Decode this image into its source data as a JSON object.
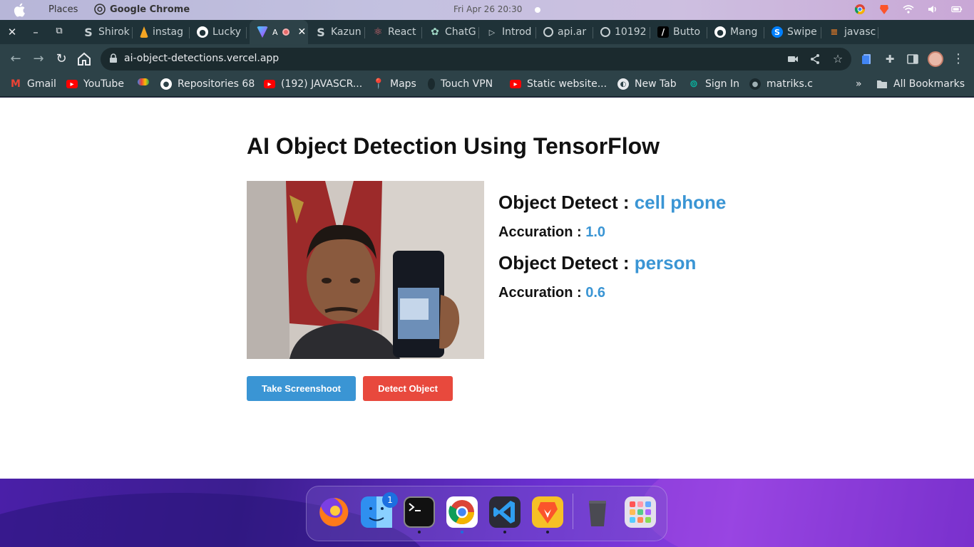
{
  "system_bar": {
    "menu_places": "Places",
    "app_name": "Google Chrome",
    "clock": "Fri Apr 26  20:30"
  },
  "tabs": [
    {
      "label": "Shirok",
      "icon": "shirok-s-icon"
    },
    {
      "label": "instag",
      "icon": "firebase-icon"
    },
    {
      "label": "Lucky",
      "icon": "github-icon"
    },
    {
      "label": "A",
      "icon": "vite-icon",
      "active": true
    },
    {
      "label": "Kazun",
      "icon": "shirok-s-icon"
    },
    {
      "label": "React",
      "icon": "react-icon"
    },
    {
      "label": "ChatG",
      "icon": "openai-icon"
    },
    {
      "label": "Introd",
      "icon": "play-icon"
    },
    {
      "label": "api.ar",
      "icon": "globe-icon"
    },
    {
      "label": "10192",
      "icon": "globe-icon"
    },
    {
      "label": "Butto",
      "icon": "slash-icon"
    },
    {
      "label": "Mang",
      "icon": "github-icon"
    },
    {
      "label": "Swipe",
      "icon": "swiper-icon"
    },
    {
      "label": "javasc",
      "icon": "stackoverflow-icon"
    }
  ],
  "toolbar": {
    "url": "ai-object-detections.vercel.app"
  },
  "bookmarks": [
    {
      "label": "Gmail",
      "icon": "gmail-icon"
    },
    {
      "label": "YouTube",
      "icon": "youtube-icon"
    },
    {
      "label": "",
      "icon": "google-cloud-icon"
    },
    {
      "label": "Repositories 68",
      "icon": "github-icon"
    },
    {
      "label": "(192) JAVASCR...",
      "icon": "youtube-icon"
    },
    {
      "label": "Maps",
      "icon": "maps-icon"
    },
    {
      "label": "Touch VPN",
      "icon": "vpn-icon"
    },
    {
      "label": "Static website...",
      "icon": "youtube-icon"
    },
    {
      "label": "New Tab",
      "icon": "globe-icon"
    },
    {
      "label": "Sign In",
      "icon": "codeium-icon"
    },
    {
      "label": "matriks.c",
      "icon": "github-icon"
    }
  ],
  "bookmarks_overflow": "»",
  "all_bookmarks": "All Bookmarks",
  "page": {
    "title": "AI Object Detection Using TensorFlow",
    "detections": [
      {
        "label_prefix": "Object Detect : ",
        "object": "cell phone",
        "acc_prefix": "Accuration : ",
        "accuracy": "1.0"
      },
      {
        "label_prefix": "Object Detect : ",
        "object": "person",
        "acc_prefix": "Accuration : ",
        "accuracy": "0.6"
      }
    ],
    "buttons": {
      "screenshot": "Take Screenshoot",
      "detect": "Detect Object"
    }
  },
  "dock": {
    "finder_badge": "1",
    "apps": [
      "firefox-icon",
      "finder-icon",
      "terminal-icon",
      "chrome-icon",
      "vscode-icon",
      "brave-icon",
      "trash-icon",
      "app-grid-icon"
    ]
  },
  "colors": {
    "accent_blue": "#3a95d4",
    "accent_red": "#e8493d",
    "chrome_dark": "#2d4248"
  }
}
